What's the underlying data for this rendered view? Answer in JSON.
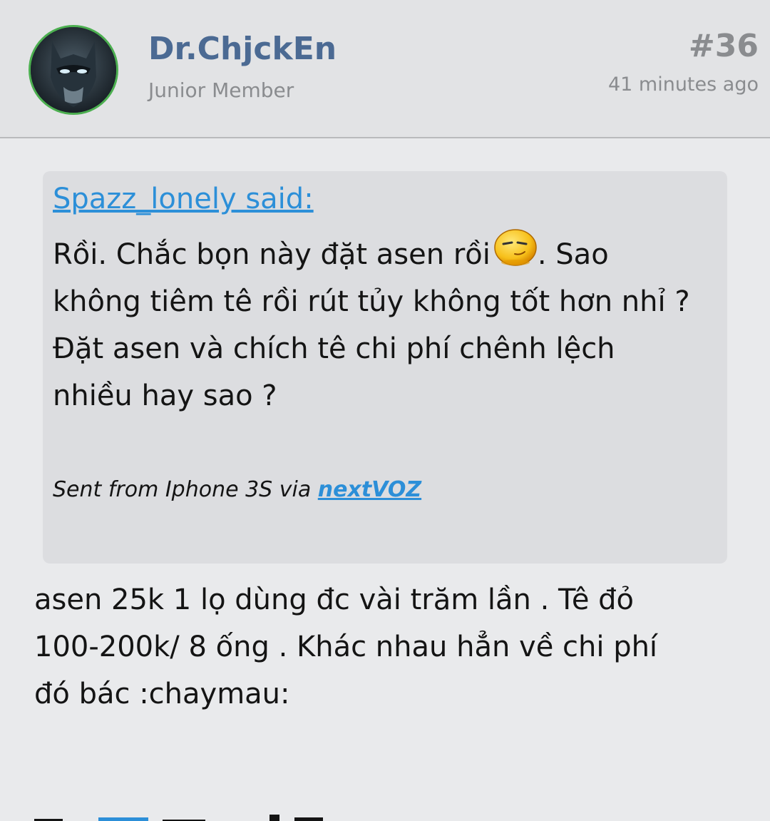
{
  "post": {
    "username": "Dr.ChjckEn",
    "user_title": "Junior Member",
    "post_number": "#36",
    "time": "41 minutes ago",
    "avatar_icon": "batman-avatar-icon"
  },
  "quote": {
    "author_label": "Spazz_lonely said:",
    "lines": [
      " Rồi. Chắc bọn này đặt asen rồi",
      ". Sao",
      "không tiêm tê rồi rút tủy không tốt hơn nhỉ ?",
      "Đặt asen và chích tê chi phí chênh lệch",
      "nhiều hay sao ?"
    ],
    "smiley_icon": "smirk-smiley-icon",
    "signature_prefix": "Sent from Iphone 3S via ",
    "signature_link": "nextVOZ"
  },
  "reply": {
    "lines": [
      "asen 25k 1 lọ dùng đc vài trăm lần . Tê đỏ",
      "100-200k/ 8 ống . Khác nhau hẳn về chi phí",
      "đó bác :chaymau:"
    ]
  },
  "colors": {
    "username": "#4b6a93",
    "link": "#2c8fd8",
    "avatar_ring": "#4caf50",
    "muted": "#8a8c8f"
  }
}
